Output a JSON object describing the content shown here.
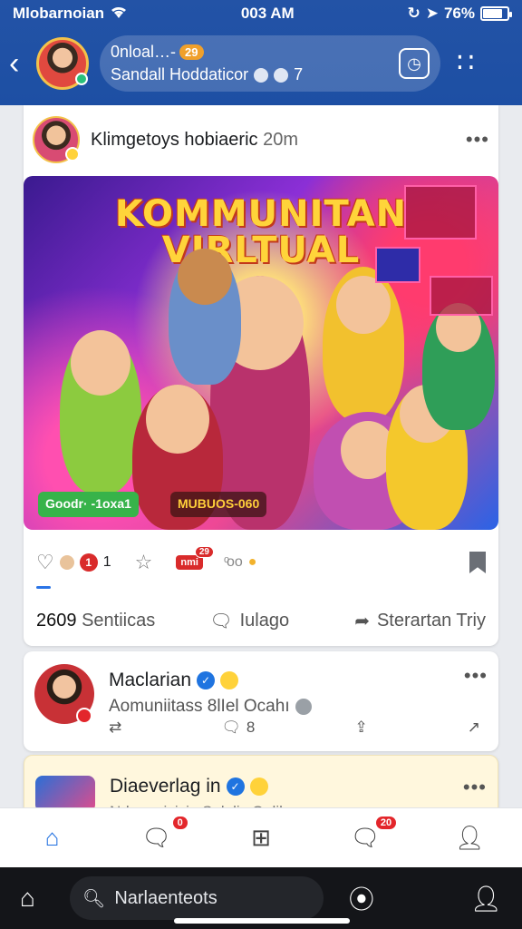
{
  "status": {
    "carrier": "Mlobarnoian",
    "time": "003 AM",
    "battery": "76%",
    "battery_level": 0.76
  },
  "header": {
    "line1": "0nloal…-",
    "badge": "29",
    "line2": "Sandall Hoddaticor",
    "small_count": "7"
  },
  "post1": {
    "author": "Klimgetoys hobiaeric",
    "time": "20m",
    "banner_title_1": "KOMMUNITAN",
    "banner_title_2": "VIRLTUAL",
    "chip_a": "Goodr· -1oxa1",
    "chip_b": "MUBUOS-060",
    "like_count": "1",
    "comment_badge": "1",
    "sticker_label": "nmi",
    "sticker_count": "29",
    "more_text": "ͦoo",
    "stat_count": "2609",
    "stat_label": "Sentiicas",
    "reply_label": "Iulago",
    "share_label": "Sterartan Triy"
  },
  "post2": {
    "author": "Maclarian",
    "subtitle": "Aomuniitass 8lІel Ocahı",
    "comments": "8"
  },
  "post3": {
    "author": "Diaeverlag in",
    "subtitle": "Ndonunisicio Selelic Oolila"
  },
  "tabs": {
    "badge_1": "0",
    "badge_2": "20"
  },
  "search": {
    "placeholder": "Narlaenteots"
  },
  "colors": {
    "brand": "#1d4fa4",
    "accent": "#1f6fe0",
    "alert": "#e3262b"
  }
}
